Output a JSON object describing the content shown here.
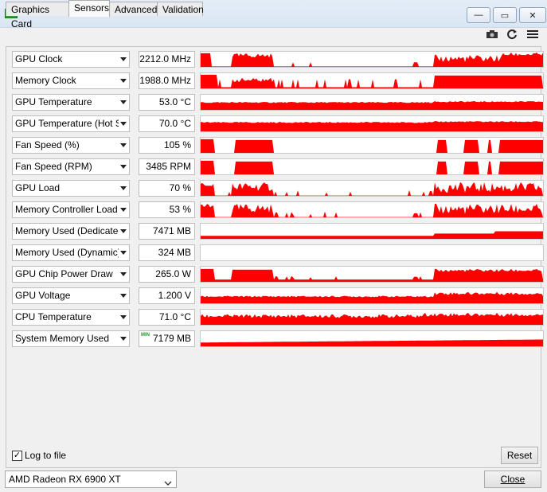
{
  "window": {
    "minimize_glyph": "—",
    "maximize_glyph": "▭",
    "close_glyph": "✕"
  },
  "tabs": [
    {
      "label": "Graphics Card",
      "active": false
    },
    {
      "label": "Sensors",
      "active": true
    },
    {
      "label": "Advanced",
      "active": false
    },
    {
      "label": "Validation",
      "active": false
    }
  ],
  "toolbar": {
    "icons": [
      "camera-icon",
      "refresh-icon",
      "menu-icon"
    ]
  },
  "sensors": [
    {
      "name": "GPU Clock",
      "value": "2212.0 MHz",
      "min_badge": "",
      "graph": "clock"
    },
    {
      "name": "Memory Clock",
      "value": "1988.0 MHz",
      "min_badge": "",
      "graph": "memclock"
    },
    {
      "name": "GPU Temperature",
      "value": "53.0 °C",
      "min_badge": "",
      "graph": "temp"
    },
    {
      "name": "GPU Temperature (Hot Spot)",
      "value": "70.0 °C",
      "min_badge": "",
      "graph": "temp2"
    },
    {
      "name": "Fan Speed (%)",
      "value": "105 %",
      "min_badge": "",
      "graph": "fan"
    },
    {
      "name": "Fan Speed (RPM)",
      "value": "3485 RPM",
      "min_badge": "",
      "graph": "fan"
    },
    {
      "name": "GPU Load",
      "value": "70 %",
      "min_badge": "",
      "graph": "load"
    },
    {
      "name": "Memory Controller Load",
      "value": "53 %",
      "min_badge": "",
      "graph": "load2"
    },
    {
      "name": "Memory Used (Dedicated)",
      "value": "7471 MB",
      "min_badge": "",
      "graph": "memused"
    },
    {
      "name": "Memory Used (Dynamic)",
      "value": "324 MB",
      "min_badge": "",
      "graph": "empty"
    },
    {
      "name": "GPU Chip Power Draw",
      "value": "265.0 W",
      "min_badge": "",
      "graph": "power"
    },
    {
      "name": "GPU Voltage",
      "value": "1.200 V",
      "min_badge": "",
      "graph": "voltage"
    },
    {
      "name": "CPU Temperature",
      "value": "71.0 °C",
      "min_badge": "",
      "graph": "cputemp"
    },
    {
      "name": "System Memory Used",
      "value": "7179 MB",
      "min_badge": "MIN",
      "graph": "sysmem"
    }
  ],
  "graph_color": "#ff0000",
  "log_to_file": {
    "label": "Log to file",
    "checked": true
  },
  "reset_label": "Reset",
  "gpu_select": {
    "value": "AMD Radeon RX 6900 XT"
  },
  "close_label": "Close"
}
